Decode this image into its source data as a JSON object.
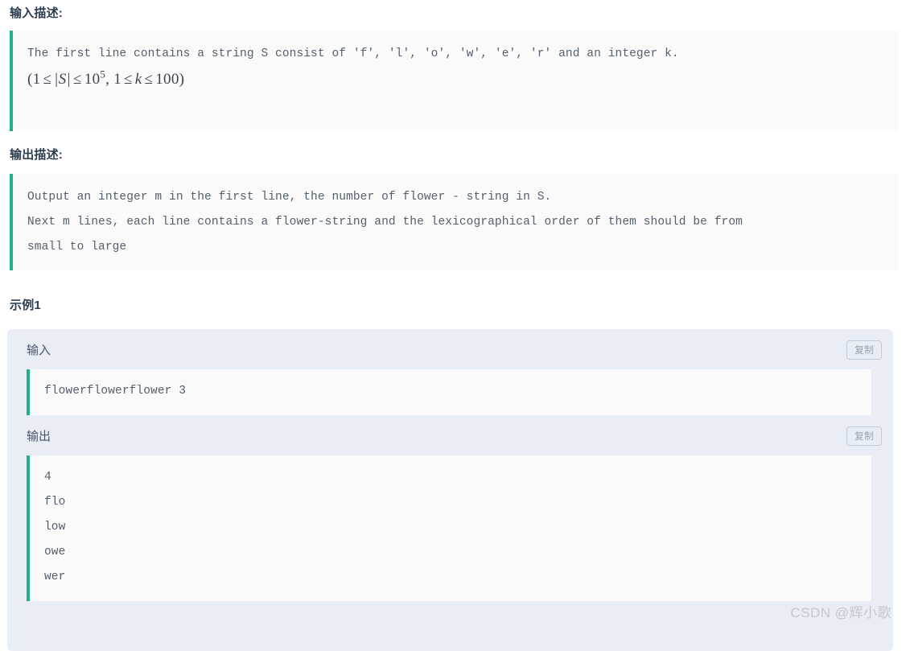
{
  "sections": {
    "input_description": {
      "heading": "输入描述:",
      "lines": [
        "The first line contains a string S consist of 'f', 'l', 'o', 'w', 'e', 'r' and an integer k."
      ],
      "formula_text": "(1 ≤ |S| ≤ 10^5, 1 ≤ k ≤ 100)",
      "formula_parts": {
        "open": "(1",
        "le1": "≤",
        "abs_s": "|S|",
        "le2": "≤",
        "ten": "10",
        "exp": "5",
        "comma": ", 1",
        "le3": "≤",
        "k": "k",
        "le4": "≤",
        "hundred": "100",
        "close": ")"
      }
    },
    "output_description": {
      "heading": "输出描述:",
      "lines": [
        "Output an integer m in the first line, the number of flower - string in S.",
        "Next m lines, each line contains a flower-string and the lexicographical order of them should be from",
        "small to large"
      ]
    },
    "sample": {
      "heading": "示例1",
      "input": {
        "label": "输入",
        "copy_label": "复制",
        "lines": [
          "flowerflowerflower 3"
        ]
      },
      "output": {
        "label": "输出",
        "copy_label": "复制",
        "lines": [
          "4",
          "flo",
          "low",
          "owe",
          "wer"
        ]
      }
    }
  },
  "watermark": "CSDN @辉小歌",
  "colors": {
    "accent_bar": "#22b08a",
    "heading": "#2c3e50",
    "code_text": "#55606e",
    "card_bg": "#e9edf6",
    "code_bg": "#fafafa",
    "watermark": "#c3c8ce"
  }
}
